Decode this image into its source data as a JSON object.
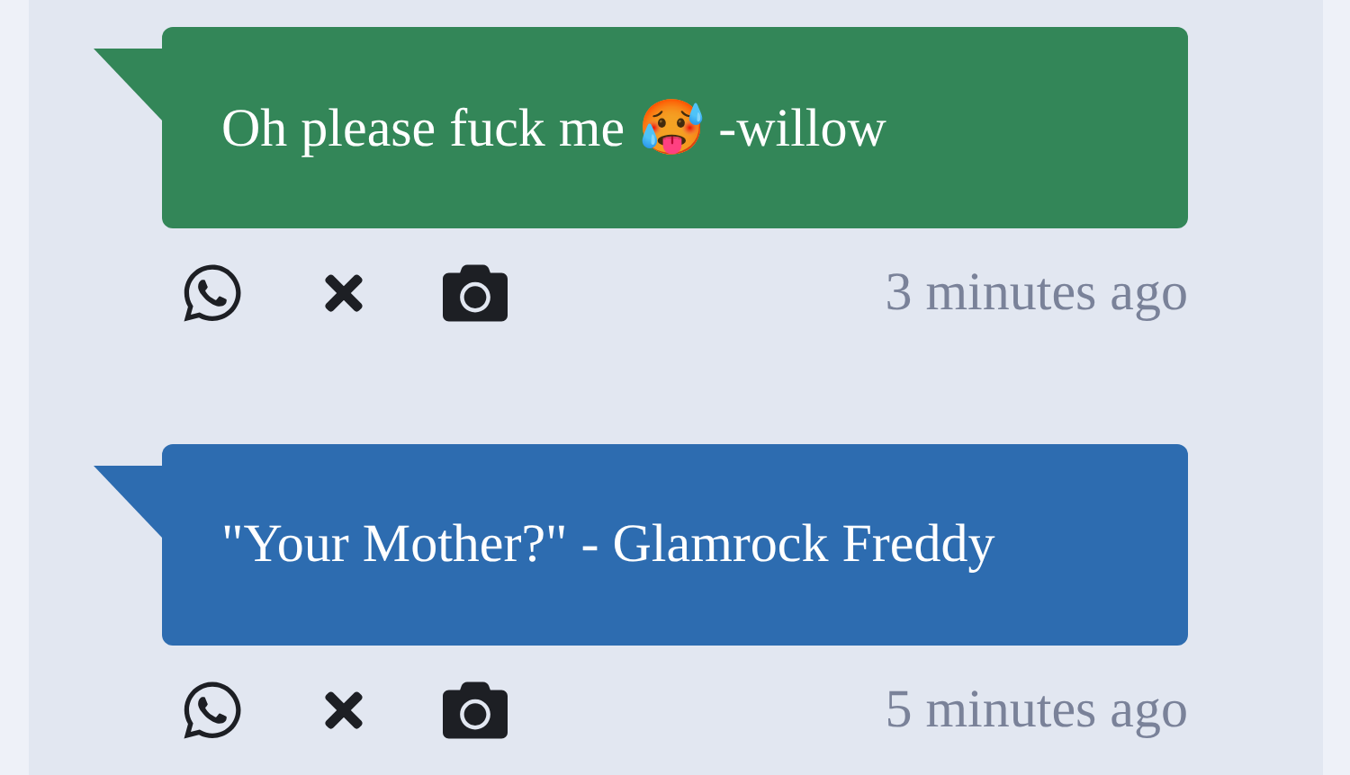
{
  "messages": [
    {
      "text": "Oh please fuck me 🥵 -willow",
      "color": "#338658",
      "time": "3 minutes ago"
    },
    {
      "text": "\"Your Mother?\" - Glamrock Freddy",
      "color": "#2d6cb0",
      "time": "5 minutes ago"
    }
  ]
}
